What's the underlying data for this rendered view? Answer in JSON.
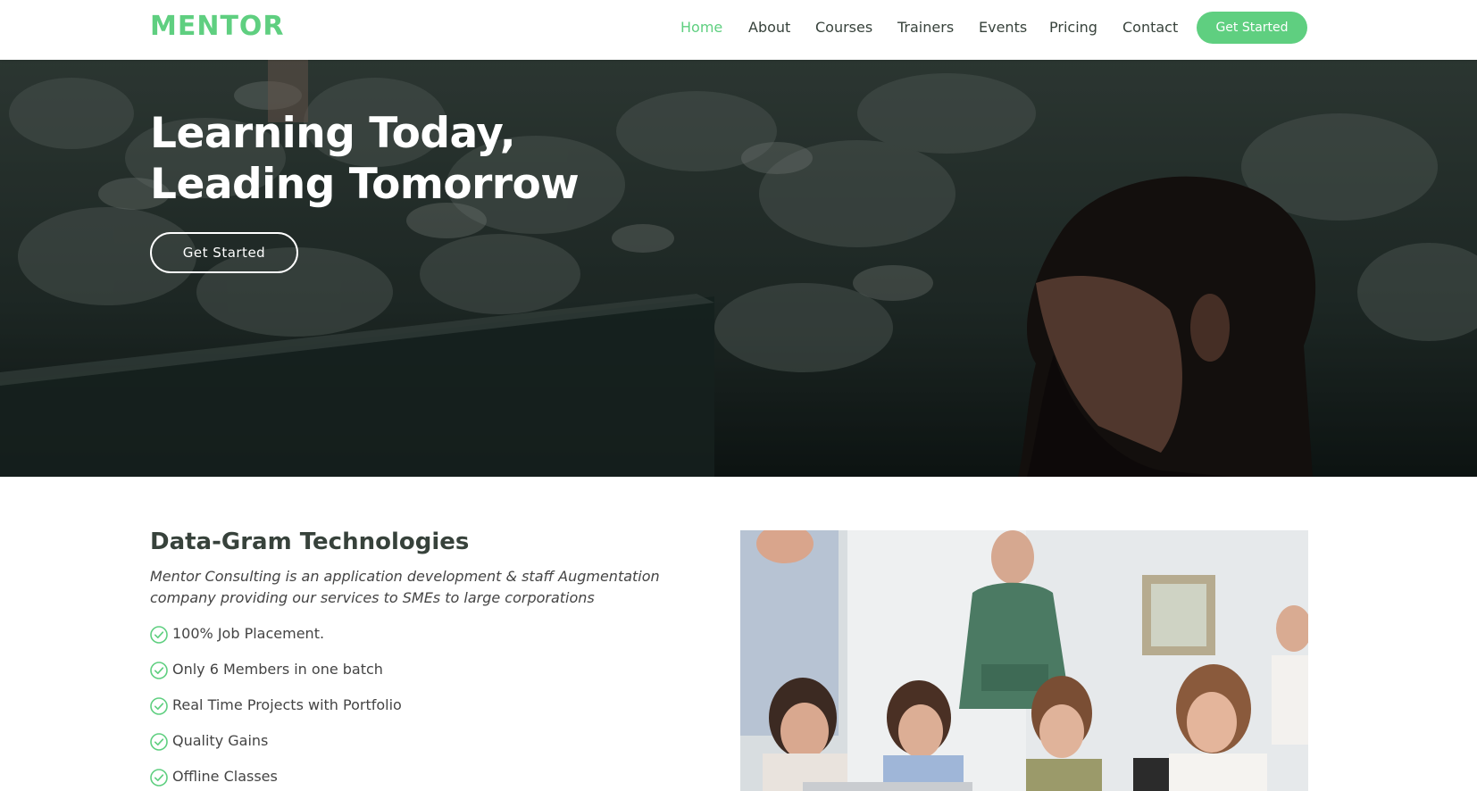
{
  "brand": {
    "name": "MENTOR",
    "color": "#5fcf80"
  },
  "nav": {
    "items": [
      {
        "label": "Home",
        "active": true
      },
      {
        "label": "About",
        "active": false
      },
      {
        "label": "Courses",
        "active": false
      },
      {
        "label": "Trainers",
        "active": false
      },
      {
        "label": "Events",
        "active": false
      },
      {
        "label": "Pricing",
        "active": false
      },
      {
        "label": "Contact",
        "active": false
      }
    ],
    "cta_label": "Get Started"
  },
  "hero": {
    "title_line1": "Learning Today,",
    "title_line2": "Leading Tomorrow",
    "cta_label": "Get Started"
  },
  "about": {
    "title": "Data-Gram Technologies",
    "description": "Mentor Consulting is an application development & staff Augmentation company providing our services to SMEs to large corporations",
    "features": [
      "100% Job Placement.",
      "Only 6 Members in one batch",
      "Real Time Projects with Portfolio",
      "Quality Gains",
      "Offline Classes"
    ],
    "feature_icon": "check-circle-icon"
  }
}
